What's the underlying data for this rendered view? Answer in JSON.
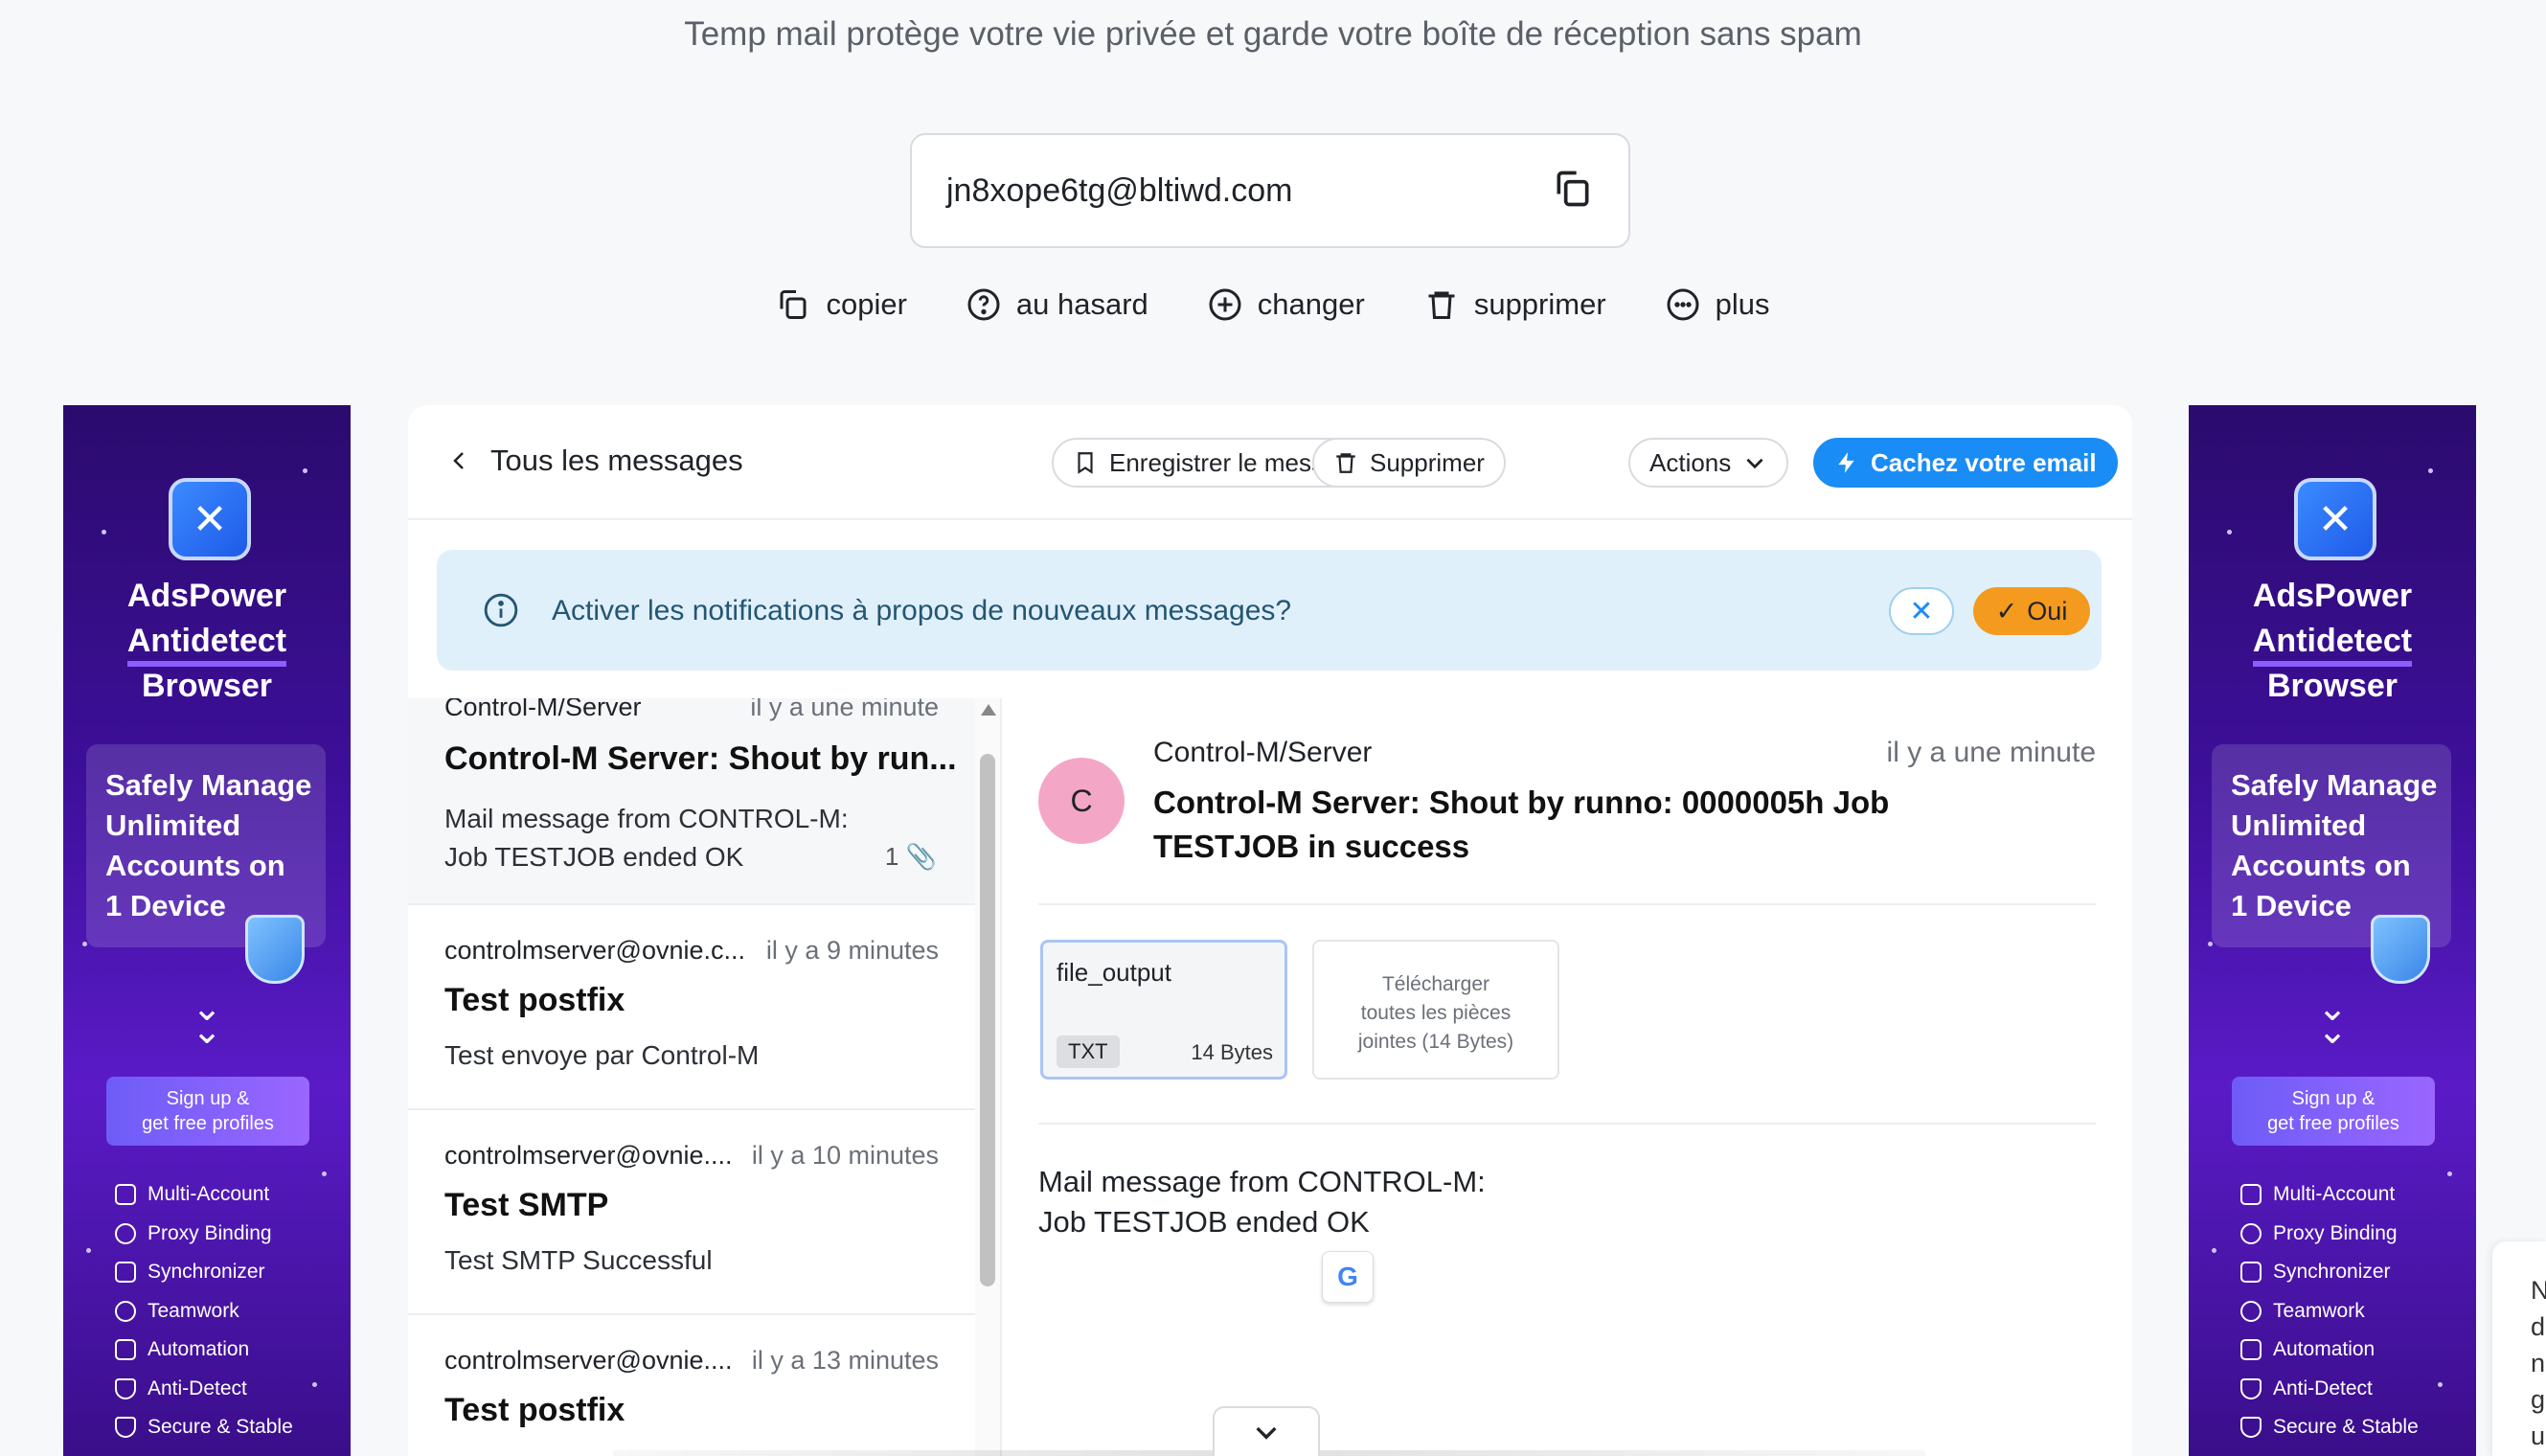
{
  "tagline": "Temp mail protège votre vie privée et garde votre boîte de réception sans spam",
  "email": {
    "address": "jn8xope6tg@bltiwd.com",
    "copy_icon": "copy-icon"
  },
  "actions": {
    "copy": "copier",
    "random": "au hasard",
    "change": "changer",
    "delete": "supprimer",
    "more": "plus"
  },
  "ad": {
    "brand_line1": "AdsPower",
    "brand_line2": "Antidetect",
    "brand_line3": "Browser",
    "promo_line1": "Safely Manage",
    "promo_line2": "Unlimited",
    "promo_line3": "Accounts on",
    "promo_line4": "1 Device",
    "signup_line1": "Sign up &",
    "signup_line2": "get free profiles",
    "features": [
      "Multi-Account",
      "Proxy Binding",
      "Synchronizer",
      "Teamwork",
      "Automation",
      "Anti-Detect",
      "Secure & Stable"
    ]
  },
  "toolbar": {
    "back": "Tous les messages",
    "save": "Enregistrer le message",
    "delete": "Supprimer",
    "actions": "Actions",
    "hide": "Cachez votre email"
  },
  "notification": {
    "text": "Activer les notifications à propos de nouveaux messages?",
    "yes": "Oui"
  },
  "messages": [
    {
      "from": "Control-M/Server",
      "time": "il y a une minute",
      "subject": "Control-M Server: Shout by run...",
      "preview_line1": "Mail message from CONTROL-M:",
      "preview_line2": "Job TESTJOB ended OK",
      "attachments": "1"
    },
    {
      "from": "controlmserver@ovnie.c...",
      "time": "il y a 9 minutes",
      "subject": "Test postfix",
      "preview_line1": "Test envoye par Control-M"
    },
    {
      "from": "controlmserver@ovnie....",
      "time": "il y a 10 minutes",
      "subject": "Test SMTP",
      "preview_line1": "Test SMTP Successful"
    },
    {
      "from": "controlmserver@ovnie....",
      "time": "il y a 13 minutes",
      "subject": "Test postfix"
    }
  ],
  "detail": {
    "avatar": "C",
    "from": "Control-M/Server",
    "time": "il y a une minute",
    "subject": "Control-M Server: Shout by runno: 0000005h Job TESTJOB in success",
    "attachment": {
      "name": "file_output",
      "type": "TXT",
      "size": "14 Bytes"
    },
    "download_line1": "Télécharger",
    "download_line2": "toutes les pièces",
    "download_line3": "jointes (14 Bytes)",
    "body_line1": "Mail message from CONTROL-M:",
    "body_line2": "Job TESTJOB ended OK"
  },
  "side_widget_letters": [
    "N",
    "d",
    "n",
    "g",
    "u"
  ],
  "colors": {
    "accent": "#1a8cf5",
    "yes_button": "#f39a1f",
    "notif_bg": "#e0f0fb",
    "avatar": "#f4a6c6",
    "ad_purple": "#3d0f99"
  }
}
